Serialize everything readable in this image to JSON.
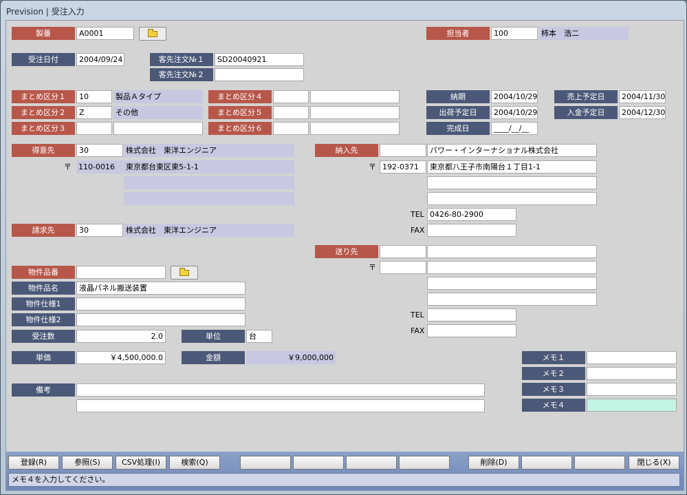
{
  "window": {
    "title": "Prevision | 受注入力"
  },
  "header": {
    "seiban_label": "製番",
    "seiban_value": "A0001",
    "tantou_label": "担当者",
    "tantou_code": "100",
    "tantou_name": "柿本　浩二"
  },
  "order": {
    "date_label": "受注日付",
    "date_value": "2004/09/24",
    "cust_no1_label": "客先注文№１",
    "cust_no1_value": "SD20040921",
    "cust_no2_label": "客先注文№２",
    "cust_no2_value": ""
  },
  "groups": {
    "g1_label": "まとめ区分１",
    "g1_code": "10",
    "g1_name": "製品Ａタイプ",
    "g2_label": "まとめ区分２",
    "g2_code": "Z",
    "g2_name": "その他",
    "g3_label": "まとめ区分３",
    "g3_code": "",
    "g3_name": "",
    "g4_label": "まとめ区分４",
    "g4_code": "",
    "g4_name": "",
    "g5_label": "まとめ区分５",
    "g5_code": "",
    "g5_name": "",
    "g6_label": "まとめ区分６",
    "g6_code": "",
    "g6_name": ""
  },
  "dates": {
    "nouki_label": "納期",
    "nouki_value": "2004/10/29",
    "uriage_label": "売上予定日",
    "uriage_value": "2004/11/30",
    "shukka_label": "出荷予定日",
    "shukka_value": "2004/10/29",
    "nyukin_label": "入金予定日",
    "nyukin_value": "2004/12/30",
    "kansei_label": "完成日",
    "kansei_value": "____/__/__"
  },
  "customer": {
    "label": "得意先",
    "code": "30",
    "name": "株式会社　東洋エンジニア",
    "zip_mark": "〒",
    "zip": "110-0016",
    "addr1": "東京都台東区東5-1-1",
    "addr2": "",
    "addr3": ""
  },
  "billing": {
    "label": "請求先",
    "code": "30",
    "name": "株式会社　東洋エンジニア"
  },
  "delivery": {
    "label": "納入先",
    "code": "",
    "name": "パワー・インターナショナル株式会社",
    "zip_mark": "〒",
    "zip": "192-0371",
    "addr1": "東京都八王子市南陽台１丁目1-1",
    "addr2": "",
    "addr3": "",
    "tel_label": "TEL",
    "tel": "0426-80-2900",
    "fax_label": "FAX",
    "fax": ""
  },
  "shipto": {
    "label": "送り先",
    "code": "",
    "name": "",
    "zip_mark": "〒",
    "zip": "",
    "addr1": "",
    "addr2": "",
    "addr3": "",
    "tel_label": "TEL",
    "tel": "",
    "fax_label": "FAX",
    "fax": ""
  },
  "item": {
    "code_label": "物件品番",
    "code_value": "",
    "name_label": "物件品名",
    "name_value": "液晶パネル搬送装置",
    "spec1_label": "物件仕様1",
    "spec1_value": "",
    "spec2_label": "物件仕様2",
    "spec2_value": "",
    "qty_label": "受注数",
    "qty_value": "2.0",
    "unit_label": "単位",
    "unit_value": "台",
    "price_label": "単価",
    "price_value": "￥4,500,000.0",
    "amount_label": "金額",
    "amount_value": "￥9,000,000",
    "remarks_label": "備考",
    "remarks1": "",
    "remarks2": ""
  },
  "memo": {
    "m1_label": "メモ１",
    "m1_value": "",
    "m2_label": "メモ２",
    "m2_value": "",
    "m3_label": "メモ３",
    "m3_value": "",
    "m4_label": "メモ４",
    "m4_value": ""
  },
  "buttons": {
    "register": "登録(R)",
    "reference": "参照(S)",
    "csv": "CSV処理(I)",
    "search": "検索(Q)",
    "delete": "削除(D)",
    "close": "閉じる(X)"
  },
  "status": {
    "message": "メモ４を入力してください。"
  },
  "colors": {
    "label_red": "#b7574a",
    "label_blue": "#4b5878",
    "readonly": "#c8c8e2",
    "memo4_active": "#c2f4e4"
  }
}
